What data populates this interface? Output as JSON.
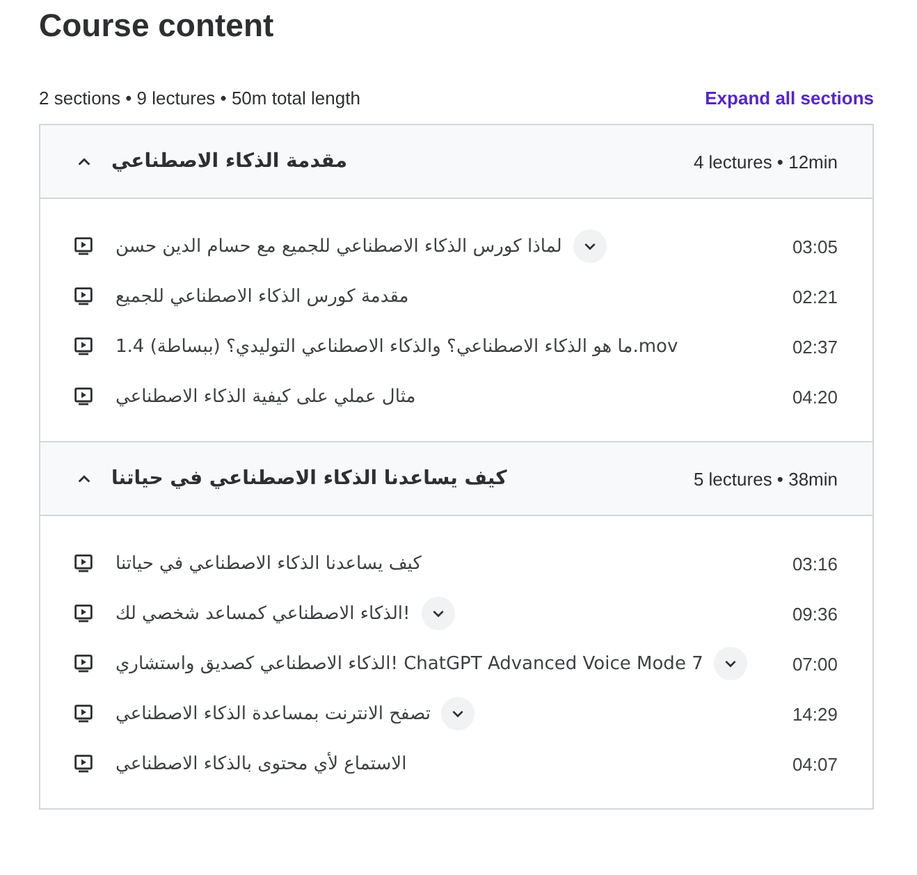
{
  "title": "Course content",
  "summary": "2 sections • 9 lectures • 50m total length",
  "expand_all": "Expand all sections",
  "sections": [
    {
      "title": "مقدمة الذكاء الاصطناعي",
      "meta": "4 lectures • 12min",
      "expanded": true,
      "lectures": [
        {
          "title": "لماذا كورس الذكاء الاصطناعي للجميع مع حسام الدين حسن",
          "duration": "03:05",
          "has_description": true
        },
        {
          "title": "مقدمة كورس الذكاء الاصطناعي للجميع",
          "duration": "02:21",
          "has_description": false
        },
        {
          "title": "ما هو الذكاء الاصطناعي؟ والذكاء الاصطناعي التوليدي؟ (ببساطة) 1.4.mov",
          "duration": "02:37",
          "has_description": false
        },
        {
          "title": "مثال عملي على كيفية الذكاء الاصطناعي",
          "duration": "04:20",
          "has_description": false
        }
      ]
    },
    {
      "title": "كيف يساعدنا الذكاء الاصطناعي في حياتنا",
      "meta": "5 lectures • 38min",
      "expanded": true,
      "lectures": [
        {
          "title": "كيف يساعدنا الذكاء الاصطناعي في حياتنا",
          "duration": "03:16",
          "has_description": false
        },
        {
          "title": "الذكاء الاصطناعي كمساعد شخصي لك!",
          "duration": "09:36",
          "has_description": true
        },
        {
          "title": "الذكاء الاصطناعي كصديق واستشاري! ChatGPT Advanced Voice Mode 7",
          "duration": "07:00",
          "has_description": true
        },
        {
          "title": "تصفح الانترنت بمساعدة الذكاء الاصطناعي",
          "duration": "14:29",
          "has_description": true
        },
        {
          "title": "الاستماع لأي محتوى بالذكاء الاصطناعي",
          "duration": "04:07",
          "has_description": false
        }
      ]
    }
  ]
}
